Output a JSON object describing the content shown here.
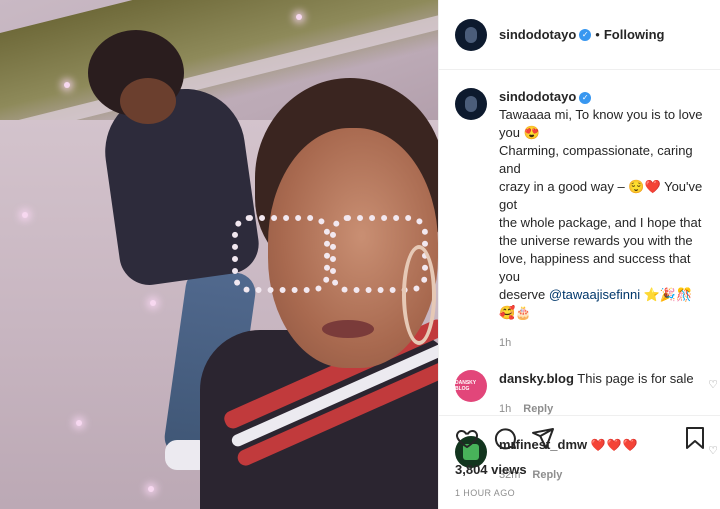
{
  "post": {
    "username": "sindodotayo",
    "follow_status": "Following",
    "caption_lines": [
      "Tawaaaa mi, To know you is to love",
      "you 😍",
      "Charming, compassionate, caring and",
      "crazy in a good way – 😌❤️ You've got",
      "the whole package, and I hope that",
      "the universe rewards you with the",
      "love, happiness and success that you",
      "deserve"
    ],
    "mention": "@tawaajisefinni",
    "caption_emojis": " ⭐🎉🎊🥰🎂",
    "caption_age": "1h",
    "views": "3,804 views",
    "posted_ago": "1 HOUR AGO"
  },
  "comments": [
    {
      "username": "dansky.blog",
      "avatar_text": "DANSKY BLOG",
      "text": "This page is for sale",
      "age": "1h",
      "reply_label": "Reply"
    },
    {
      "username": "mrfinest_dmw",
      "text": "❤️❤️❤️",
      "age": "32m",
      "reply_label": "Reply"
    }
  ],
  "icons": {
    "verified": "verified-badge-icon",
    "like": "heart-icon",
    "comment": "comment-icon",
    "share": "share-icon",
    "save": "bookmark-icon"
  },
  "colors": {
    "verified_blue": "#3897f0",
    "muted_text": "#8e8e8e",
    "mention": "#00376b"
  }
}
